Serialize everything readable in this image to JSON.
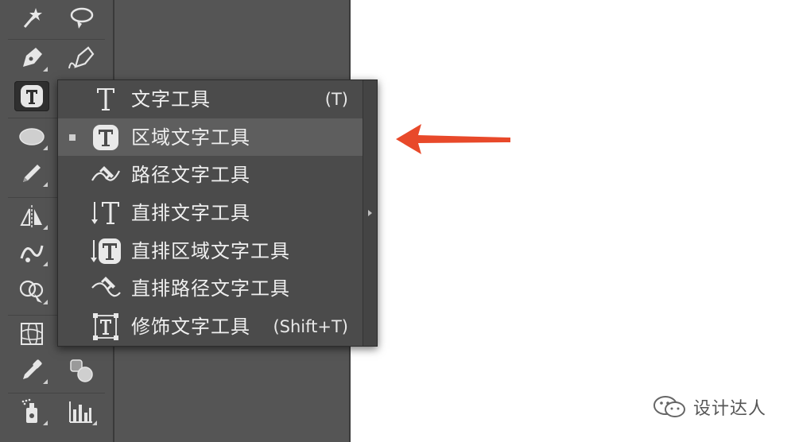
{
  "flyout": {
    "items": [
      {
        "icon": "type-tool-icon",
        "label": "文字工具",
        "shortcut": "(T)",
        "selected": false
      },
      {
        "icon": "area-type-tool-icon",
        "label": "区域文字工具",
        "shortcut": "",
        "selected": true
      },
      {
        "icon": "type-on-path-tool-icon",
        "label": "路径文字工具",
        "shortcut": "",
        "selected": false
      },
      {
        "icon": "vertical-type-tool-icon",
        "label": "直排文字工具",
        "shortcut": "",
        "selected": false
      },
      {
        "icon": "vertical-area-type-tool-icon",
        "label": "直排区域文字工具",
        "shortcut": "",
        "selected": false
      },
      {
        "icon": "vertical-type-on-path-tool-icon",
        "label": "直排路径文字工具",
        "shortcut": "",
        "selected": false
      },
      {
        "icon": "touch-type-tool-icon",
        "label": "修饰文字工具",
        "shortcut": "(Shift+T)",
        "selected": false
      }
    ]
  },
  "annotation": {
    "arrow_color": "#e8492a"
  },
  "watermark": {
    "text": "设计达人"
  },
  "colors": {
    "toolbar_bg": "#535353",
    "menu_bg": "#4b4b4b",
    "menu_selected": "#5e5e5e",
    "canvas": "#ffffff"
  }
}
